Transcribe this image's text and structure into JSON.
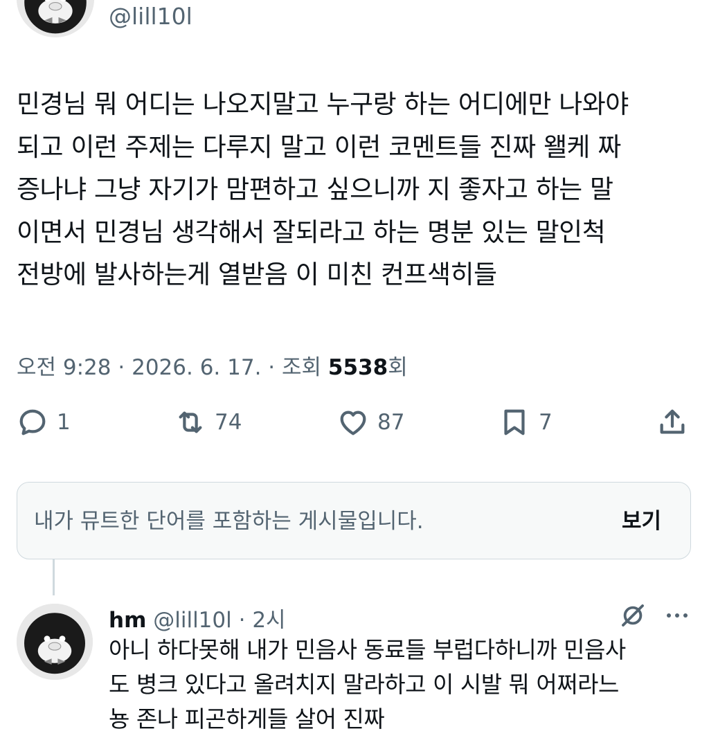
{
  "tweet": {
    "handle": "@lill10l",
    "text": "민경님 뭐 어디는 나오지말고 누구랑 하는 어디에만 나와야\n되고 이런 주제는 다루지 말고 이런 코멘트들 진짜 왤케 짜\n증나냐 그냥 자기가 맘편하고 싶으니까 지 좋자고 하는 말\n이면서 민경님 생각해서 잘되라고 하는 명분 있는 말인척\n전방에 발사하는게 열받음 이 미친 컨프색히들",
    "time": "오전 9:28",
    "date": "2026. 6. 17.",
    "views_label": "조회",
    "views": "5538",
    "views_suffix": "회",
    "sep": "·"
  },
  "actions": {
    "replies": "1",
    "retweets": "74",
    "likes": "87",
    "bookmarks": "7"
  },
  "muted": {
    "text": "내가 뮤트한 단어를 포함하는 게시물입니다.",
    "view_label": "보기"
  },
  "reply": {
    "name": "hm",
    "handle": "@lill10l",
    "dot": "·",
    "time": "2시",
    "text": "아니 하다못해 내가 민음사 동료들 부럽다하니까 민음사\n도 병크 있다고 올려치지 말라하고 이 시발 뭐 어쩌라느\n뇽 존나 피곤하게들 살어 진짜"
  },
  "icons": {
    "reply": "reply-icon",
    "retweet": "retweet-icon",
    "like": "heart-icon",
    "bookmark": "bookmark-icon",
    "share": "share-icon",
    "grok": "grok-icon",
    "more": "more-icon"
  }
}
